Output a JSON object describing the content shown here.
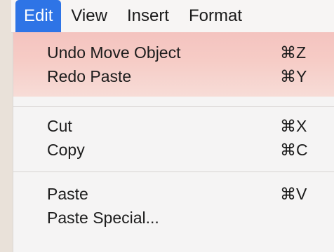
{
  "menubar": {
    "items": [
      {
        "label": "Edit",
        "active": true
      },
      {
        "label": "View",
        "active": false
      },
      {
        "label": "Insert",
        "active": false
      },
      {
        "label": "Format",
        "active": false
      }
    ]
  },
  "dropdown": {
    "groups": [
      {
        "items": [
          {
            "label": "Undo Move Object",
            "shortcut": "⌘Z"
          },
          {
            "label": "Redo Paste",
            "shortcut": "⌘Y"
          }
        ]
      },
      {
        "items": [
          {
            "label": "Cut",
            "shortcut": "⌘X"
          },
          {
            "label": "Copy",
            "shortcut": "⌘C"
          }
        ]
      },
      {
        "items": [
          {
            "label": "Paste",
            "shortcut": "⌘V"
          },
          {
            "label": "Paste Special...",
            "shortcut": ""
          }
        ]
      }
    ]
  },
  "colors": {
    "accent": "#2e74e6",
    "highlight": "#f5c8c3",
    "menu_bg": "#f5f4f4"
  }
}
